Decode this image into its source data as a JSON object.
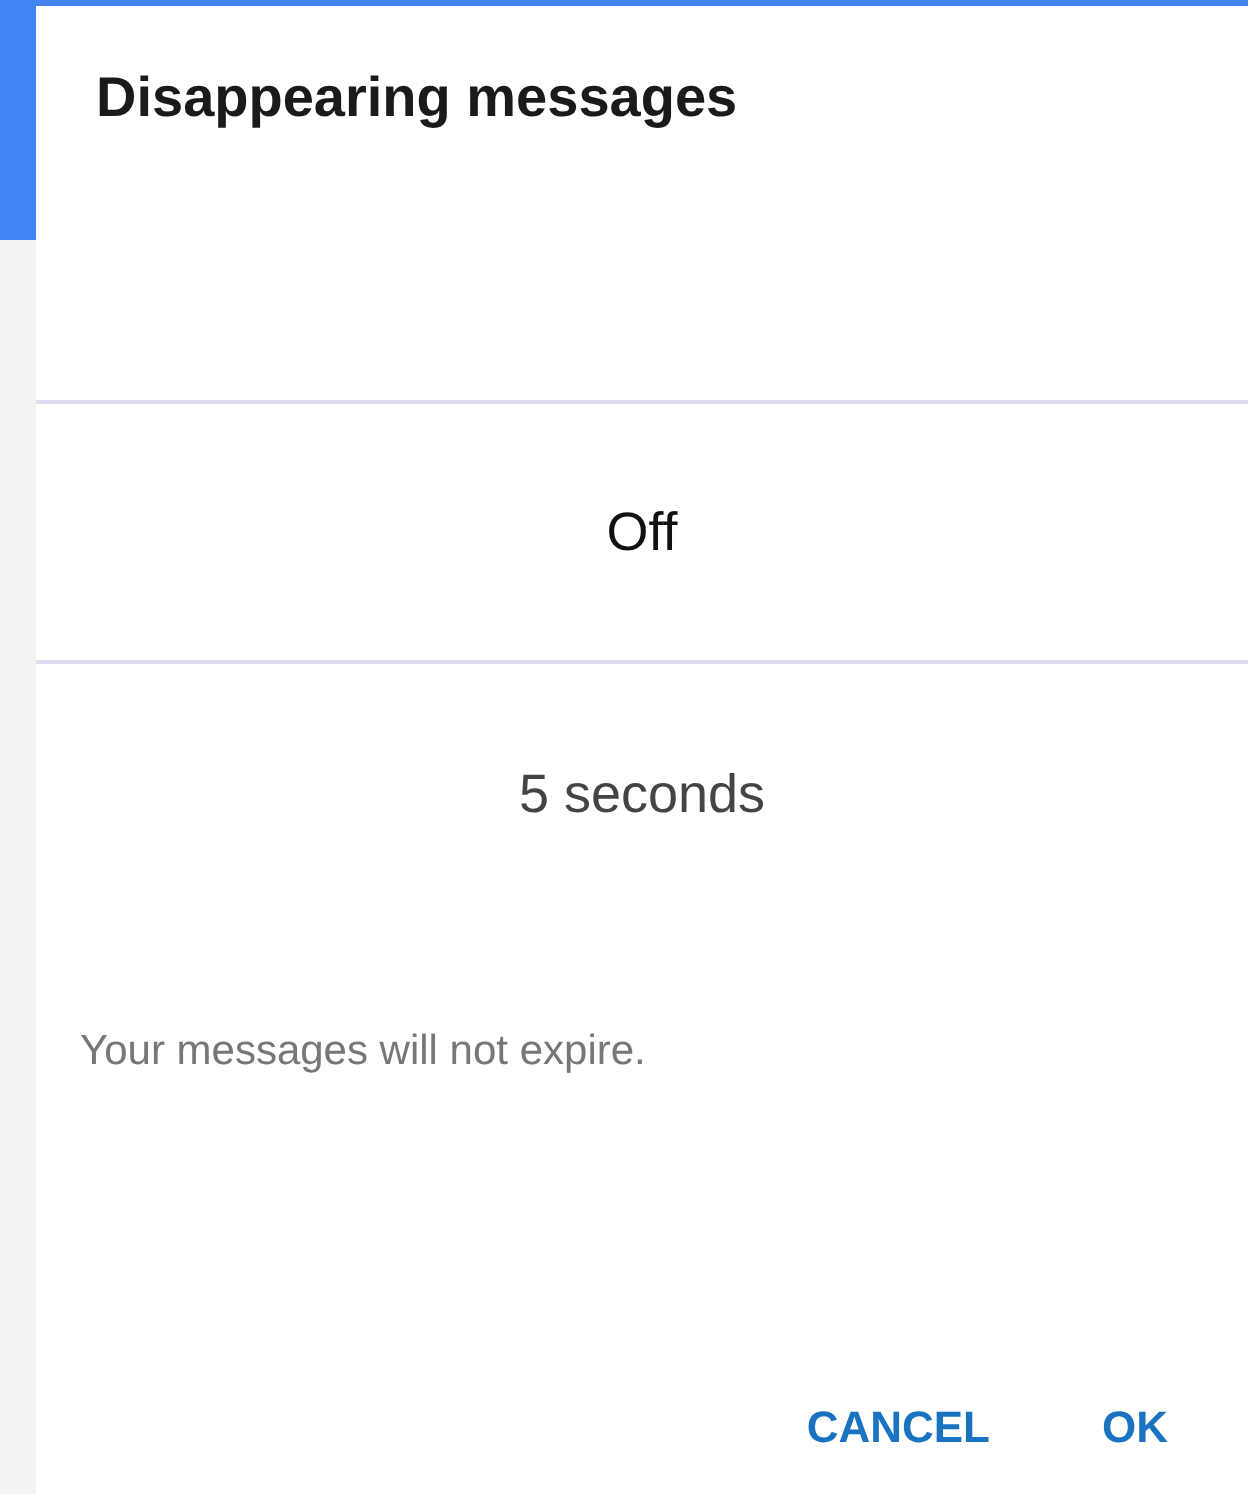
{
  "dialog": {
    "title": "Disappearing messages"
  },
  "picker": {
    "options": [
      {
        "label": "Off",
        "selected": true
      },
      {
        "label": "5 seconds",
        "selected": false
      }
    ]
  },
  "message": "Your messages will not expire.",
  "buttons": [
    {
      "label": "CANCEL"
    },
    {
      "label": "OK"
    }
  ]
}
